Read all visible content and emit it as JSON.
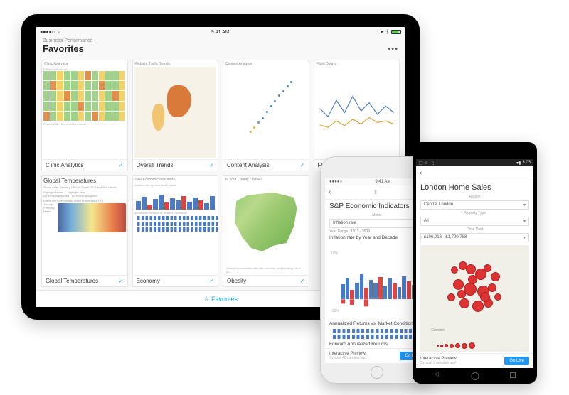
{
  "tablet": {
    "status": {
      "time": "9:41 AM",
      "signal": "●●●●●",
      "wifi": "wifi",
      "battery": "battery-full"
    },
    "breadcrumb": "Business Performance",
    "title": "Favorites",
    "more": "•••",
    "bottom_tab": "Favorites",
    "cards": [
      {
        "header": "Clinic Analytics",
        "label": "Clinic Analytics",
        "thumb": "heat"
      },
      {
        "header": "Website Traffic Trends",
        "label": "Overall Trends",
        "thumb": "world"
      },
      {
        "header": "Content Analysis",
        "label": "Content Analysis",
        "thumb": "scatter"
      },
      {
        "header": "Flight Delays",
        "label": "Flight Delays",
        "thumb": "line-blue"
      },
      {
        "header": "Global Temperatures",
        "subtext": "Select date — Highlight Month / Highlight Year / Difference from median global temperature (°C)",
        "label": "Global Temperatures",
        "thumb": "gradient"
      },
      {
        "header": "S&P Economic Indicators",
        "label": "Economy",
        "thumb": "econ"
      },
      {
        "header": "Is Your County Obese?",
        "subtext": "Obesity's correlation with diet, exercise, and smoking (% of po...",
        "label": "Obesity",
        "thumb": "usmap"
      }
    ]
  },
  "iphone": {
    "status_time": "9:41 AM",
    "back": "‹",
    "title": "S&P Economic Indicators",
    "metric_label": "Metric",
    "metric_value": "Inflation rate",
    "range_label": "Year Range",
    "range_value": "1913 - 2009",
    "section1": "Inflation rate by Year and Decade",
    "y_top": "10%",
    "y_bot": "-10%",
    "section2": "Annualized Returns vs. Market Conditions",
    "section3": "Forward Annualized Returns",
    "footer_label": "Interactive Preview",
    "footer_sync": "Synced 48 minutes ago",
    "go_live": "Go Live"
  },
  "android": {
    "status_time": "3:03",
    "title": "London Home Sales",
    "labels": {
      "region": "Region",
      "ptype": "Property Type",
      "price": "Price Paid"
    },
    "dropdowns": {
      "region": "Central London",
      "ptype": "All",
      "price": "£106,016 - £1,790,788"
    },
    "map_label": "Camden",
    "footer_label": "Interactive Preview",
    "footer_sync": "Synced 3 minutes ago",
    "go_live": "Go Live"
  }
}
